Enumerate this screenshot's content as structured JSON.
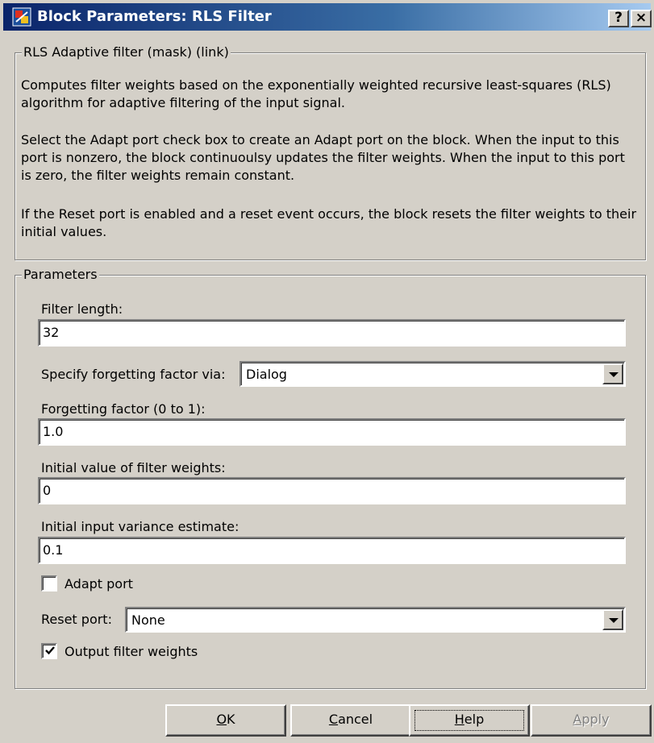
{
  "window": {
    "title": "Block Parameters: RLS Filter",
    "help_button": "?",
    "close_button": "×"
  },
  "description_group": {
    "legend": "RLS Adaptive filter (mask) (link)",
    "paragraphs": [
      "Computes filter weights based on the exponentially weighted recursive least-squares (RLS) algorithm for adaptive filtering of the input signal.",
      "Select the Adapt port check box to create an Adapt port on the block. When the input to this port is nonzero, the block continuoulsy updates the filter weights. When the input to this port is zero, the filter weights remain constant.",
      "If the Reset port is enabled and a reset event occurs, the block resets the filter weights to their initial values."
    ]
  },
  "parameters_group": {
    "legend": "Parameters",
    "filter_length_label": "Filter length:",
    "filter_length_value": "32",
    "forgetting_source_label": "Specify forgetting factor via:",
    "forgetting_source_value": "Dialog",
    "forgetting_factor_label": "Forgetting factor (0 to 1):",
    "forgetting_factor_value": "1.0",
    "initial_weights_label": "Initial value of filter weights:",
    "initial_weights_value": "0",
    "initial_variance_label": "Initial input variance estimate:",
    "initial_variance_value": "0.1",
    "adapt_port_label": "Adapt port",
    "adapt_port_checked": false,
    "reset_port_label": "Reset port:",
    "reset_port_value": "None",
    "output_weights_label": "Output filter weights",
    "output_weights_checked": true
  },
  "buttons": {
    "ok_mnemonic": "O",
    "ok_rest": "K",
    "cancel_mnemonic": "C",
    "cancel_rest": "ancel",
    "help_mnemonic": "H",
    "help_rest": "elp",
    "apply_mnemonic": "A",
    "apply_rest": "pply"
  },
  "colors": {
    "face": "#d4d0c8",
    "titlebar_start": "#0a246a",
    "titlebar_end": "#a6caf0",
    "disabled_text": "#808080"
  },
  "icons": {
    "app": "simulink-block-icon",
    "help": "help-icon",
    "close": "close-icon",
    "dropdown": "chevron-down-icon",
    "check": "checkmark-icon"
  }
}
